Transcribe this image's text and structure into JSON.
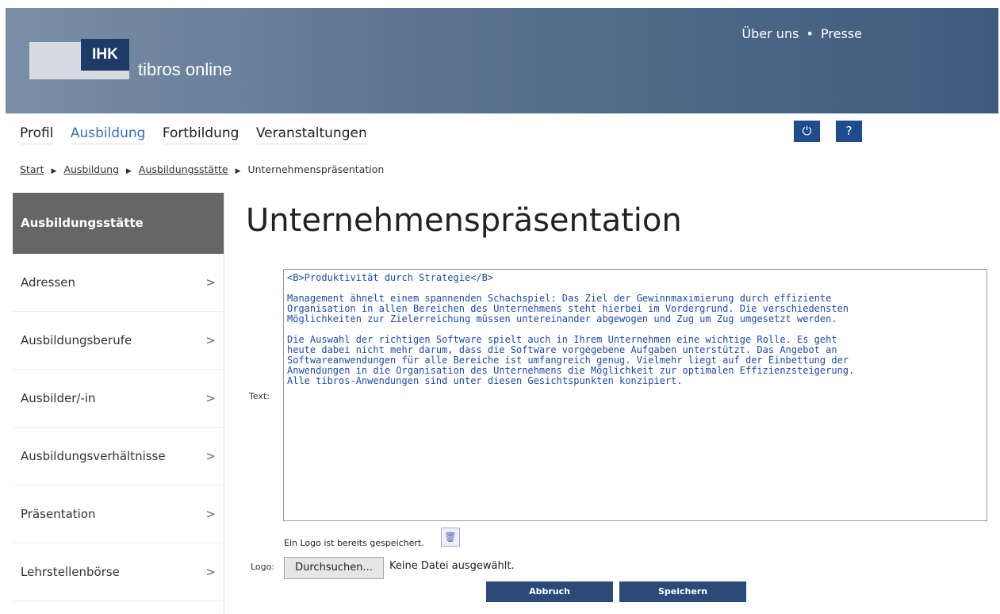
{
  "header": {
    "logo_tag": "IHK",
    "logo_text": "tibros online",
    "links": [
      "Über uns",
      "•",
      "Presse"
    ]
  },
  "nav": {
    "items": [
      "Profil",
      "Ausbildung",
      "Fortbildung",
      "Veranstaltungen"
    ],
    "icons": {
      "power": "⏻",
      "help": "?"
    }
  },
  "breadcrumb": [
    "Start",
    "Ausbildung",
    "Ausbildungsstätte",
    "Unternehmenspräsentation"
  ],
  "sidebar": {
    "head": "Ausbildungsstätte",
    "items": [
      "Adressen",
      "Ausbildungsberufe",
      "Ausbilder/-in",
      "Ausbildungsverhältnisse",
      "Präsentation",
      "Lehrstellenbörse"
    ],
    "chevron": ">"
  },
  "main": {
    "title": "Unternehmenspräsentation",
    "text_label": "Text:",
    "text_value": "<B>Produktivität durch Strategie</B>\n\nManagement ähnelt einem spannenden Schachspiel: Das Ziel der Gewinnmaximierung durch effiziente\nOrganisation in allen Bereichen des Unternehmens steht hierbei im Vordergrund. Die verschiedensten\nMöglichkeiten zur Zielerreichung müssen untereinander abgewogen und Zug um Zug umgesetzt werden.\n\nDie Auswahl der richtigen Software spielt auch in Ihrem Unternehmen eine wichtige Rolle. Es geht\nheute dabei nicht mehr darum, dass die Software vorgegebene Aufgaben unterstützt. Das Angebot an\nSoftwareanwendungen für alle Bereiche ist umfangreich genug. Vielmehr liegt auf der Einbettung der\nAnwendungen in die Organisation des Unternehmens die Möglichkeit zur optimalen Effizienzsteigerung.\nAlle tibros-Anwendungen sind unter diesen Gesichtspunkten konzipiert.",
    "logo_note": "Ein Logo ist bereits gespeichert.",
    "logo_label": "Logo:",
    "file_button": "Durchsuchen...",
    "file_status": "Keine Datei ausgewählt.",
    "cancel": "Abbruch",
    "save": "Speichern"
  }
}
